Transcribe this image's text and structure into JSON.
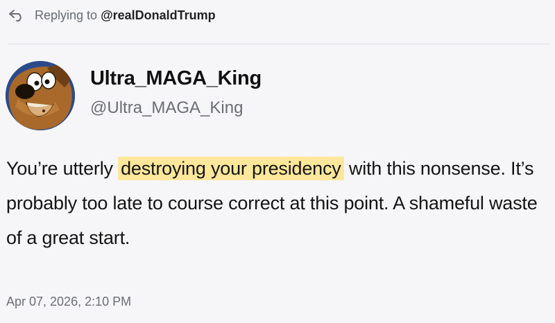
{
  "reply": {
    "icon": "reply-arrow-icon",
    "prefix": "Replying to",
    "handle": "@realDonaldTrump"
  },
  "author": {
    "avatar_icon": "cartoon-dog-avatar",
    "display_name": "Ultra_MAGA_King",
    "handle": "@Ultra_MAGA_King"
  },
  "post": {
    "text_before": "You’re utterly",
    "highlighted": "destroying your presidency",
    "text_after": "with this nonsense. It’s probably too late to course correct at this point. A shameful waste of a great start.",
    "highlight_color": "#fde79a"
  },
  "timestamp": "Apr 07, 2026, 2:10 PM"
}
